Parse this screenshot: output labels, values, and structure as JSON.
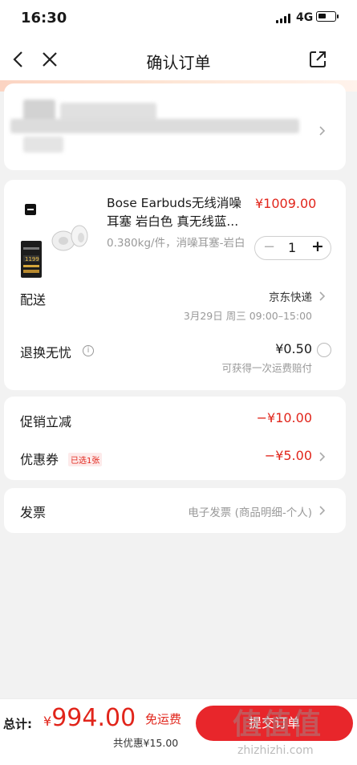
{
  "status_bar": {
    "time": "16:30",
    "network": "4G",
    "battery_level": 0.5
  },
  "nav": {
    "title": "确认订单"
  },
  "product": {
    "title": "Bose Earbuds无线消噪耳塞 岩白色 真无线蓝...",
    "price": "¥1009.00",
    "spec": "0.380kg/件，消噪耳塞-岩白",
    "quantity": "1",
    "minus": "−",
    "plus": "+",
    "thumb_price": "1199"
  },
  "delivery": {
    "label": "配送",
    "carrier": "京东快递",
    "time": "3月29日 周三 09:00–15:00"
  },
  "returns": {
    "label": "退换无忧",
    "price": "¥0.50",
    "note": "可获得一次运费赔付"
  },
  "promotion": {
    "label": "促销立减",
    "value": "−¥10.00"
  },
  "coupon": {
    "label": "优惠券",
    "tag": "已选1张",
    "value": "−¥5.00"
  },
  "invoice": {
    "label": "发票",
    "value": "电子发票 (商品明细-个人)"
  },
  "footer": {
    "total_label": "总计:",
    "currency": "¥",
    "total": "994.00",
    "free_shipping": "免运费",
    "discount": "共优惠¥15.00",
    "submit": "提交订单"
  },
  "watermark": {
    "cn": "值值值",
    "en": "zhizhizhi.com"
  },
  "colors": {
    "accent": "#e1251b",
    "background": "#f2f2f2",
    "card": "#ffffff"
  }
}
